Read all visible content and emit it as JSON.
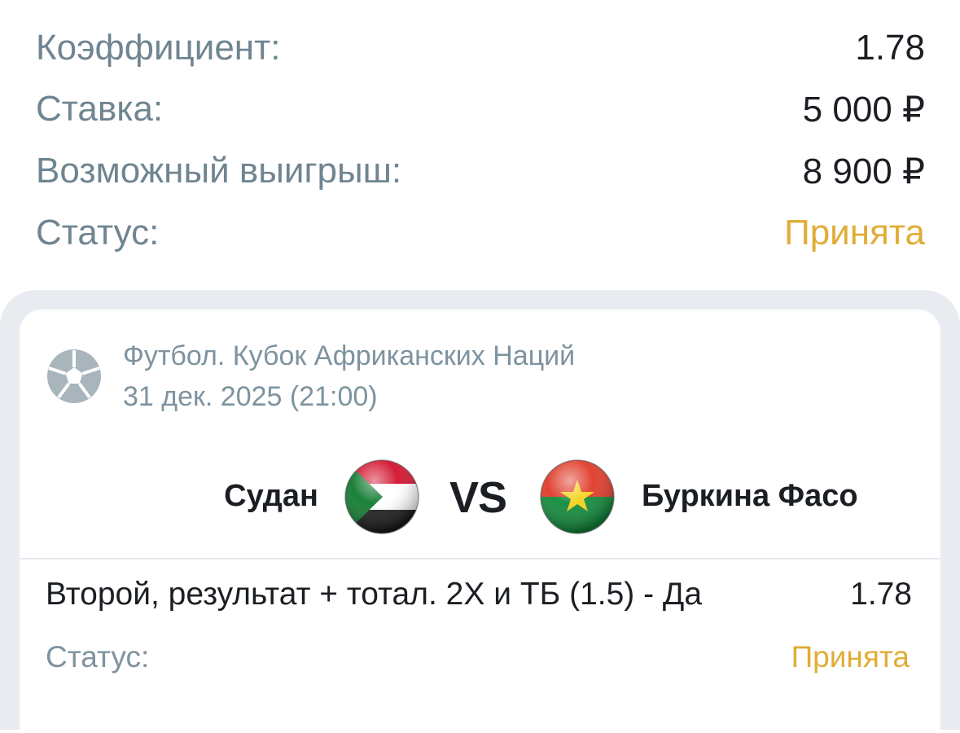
{
  "summary": {
    "coefficient_label": "Коэффициент:",
    "coefficient_value": "1.78",
    "stake_label": "Ставка:",
    "stake_value": "5 000 ₽",
    "winnings_label": "Возможный выигрыш:",
    "winnings_value": "8 900 ₽",
    "status_label": "Статус:",
    "status_value": "Принята"
  },
  "event": {
    "sport_icon": "soccer-ball-icon",
    "title": "Футбол. Кубок Африканских Наций",
    "date": "31 дек. 2025 (21:00)",
    "team1": "Судан",
    "team1_flag": "sudan-flag-icon",
    "vs": "VS",
    "team2": "Буркина Фасо",
    "team2_flag": "burkina-faso-flag-icon"
  },
  "bet": {
    "description": "Второй, результат + тотал. 2Х и ТБ (1.5) -  Да",
    "odds": "1.78",
    "status_label": "Статус:",
    "status_value": "Принята"
  },
  "colors": {
    "label": "#6f8591",
    "accent_status": "#e0ad37",
    "card_background": "#e8ecf1"
  }
}
